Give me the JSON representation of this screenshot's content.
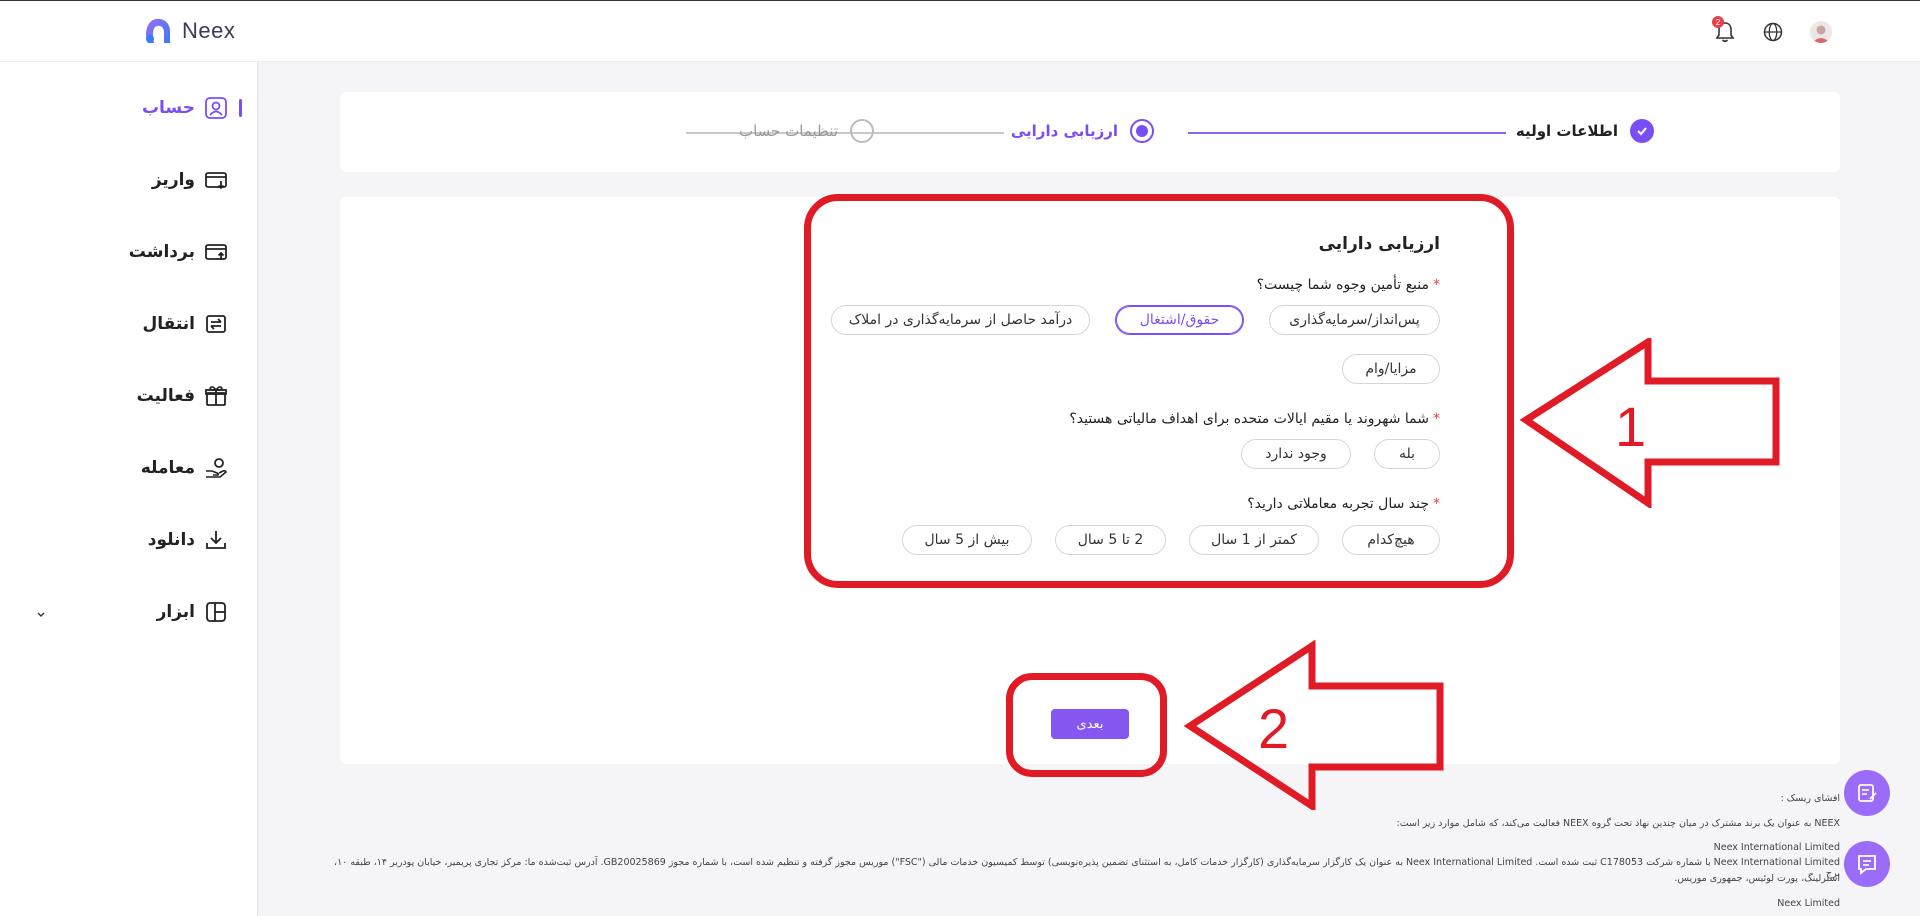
{
  "brand": {
    "name": "Neex"
  },
  "header": {
    "notification_count": "2"
  },
  "sidebar": {
    "items": [
      {
        "label": "حساب",
        "icon": "user-icon",
        "active": true
      },
      {
        "label": "واریز",
        "icon": "deposit-icon"
      },
      {
        "label": "برداشت",
        "icon": "withdraw-icon"
      },
      {
        "label": "انتقال",
        "icon": "transfer-icon"
      },
      {
        "label": "فعالیت",
        "icon": "gift-icon"
      },
      {
        "label": "معامله",
        "icon": "trade-icon"
      },
      {
        "label": "دانلود",
        "icon": "download-icon"
      },
      {
        "label": "ابزار",
        "icon": "tools-icon"
      }
    ]
  },
  "stepper": {
    "steps": [
      {
        "label": "اطلاعات اولیه",
        "state": "done"
      },
      {
        "label": "ارزیابی دارایی",
        "state": "current"
      },
      {
        "label": "تنظیمات حساب",
        "state": "pending"
      }
    ]
  },
  "form": {
    "title": "ارزیابی دارایی",
    "q1": {
      "label": "منبع تأمین وجوه شما چیست؟",
      "options": [
        "پس‌انداز/سرمایه‌گذاری",
        "حقوق/اشتغال",
        "درآمد حاصل از سرمایه‌گذاری در املاک",
        "مزایا/وام"
      ],
      "selected": "حقوق/اشتغال"
    },
    "q2": {
      "label": "شما شهروند یا مقیم ایالات متحده برای اهداف مالیاتی هستید؟",
      "options": [
        "بله",
        "وجود ندارد"
      ]
    },
    "q3": {
      "label": "چند سال تجربه معاملاتی دارید؟",
      "options": [
        "هیچ‌کدام",
        "کمتر از 1 سال",
        "2 تا 5 سال",
        "بیش از 5 سال"
      ]
    },
    "next_label": "بعدی"
  },
  "annotations": {
    "label1": "1",
    "label2": "2"
  },
  "footer": {
    "risk_title": "افشای ریسک  :",
    "line1": "NEEX به عنوان یک برند مشترک در میان چندین نهاد تحت گروه NEEX فعالیت می‌کند، که شامل موارد زیر است:",
    "entity1": "Neex International Limited",
    "line2": "Neex International Limited با شماره شرکت C178053 ثبت شده است. Neex International Limited به عنوان یک کارگزار سرمایه‌گذاری (کارگزار خدمات کامل، به استثنای تضمین پذیره‌نویسی) توسط کمیسیون خدمات مالی (\"FSC\") موریس مجوز گرفته و تنظیم شده است، با شماره مجوز GB20025869. آدرس ثبت‌شده ما: مرکز تجاری پریمیر، خیابان پودریر ۱۴، طبقه ۱۰، برج",
    "line3": "استرلینگ، پورت لوئیس، جمهوری موریس.",
    "entity2": "Neex Limited"
  },
  "colors": {
    "accent": "#7b4df5",
    "annotation": "#e11b25"
  }
}
